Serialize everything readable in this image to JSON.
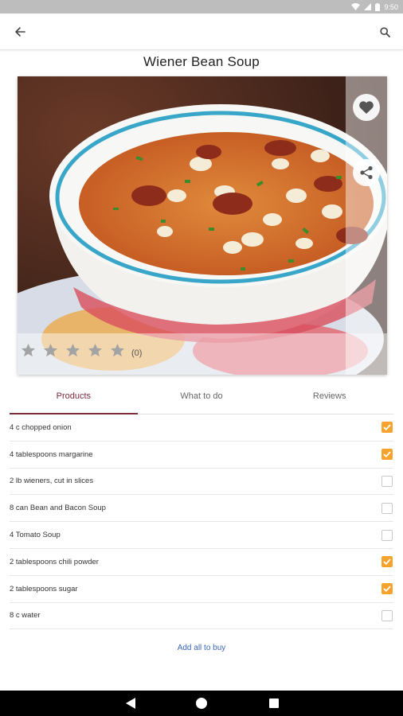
{
  "status_bar": {
    "time": "9:50",
    "icons": [
      "wifi-icon",
      "signal-icon",
      "battery-icon"
    ]
  },
  "app_bar": {
    "back_icon": "arrow-back-icon",
    "search_icon": "search-icon"
  },
  "recipe": {
    "title": "Wiener Bean Soup",
    "rating": {
      "stars_filled": 0,
      "stars_total": 5,
      "count_label": "(0)"
    }
  },
  "tabs": [
    {
      "label": "Products",
      "active": true
    },
    {
      "label": "What to do",
      "active": false
    },
    {
      "label": "Reviews",
      "active": false
    }
  ],
  "ingredients": [
    {
      "text": "4 c chopped onion",
      "checked": true
    },
    {
      "text": "4 tablespoons margarine",
      "checked": true
    },
    {
      "text": "2 lb wieners, cut in slices",
      "checked": false
    },
    {
      "text": "8 can Bean and Bacon Soup",
      "checked": false
    },
    {
      "text": "4 Tomato Soup",
      "checked": false
    },
    {
      "text": "2 tablespoons chili powder",
      "checked": true
    },
    {
      "text": "2 tablespoons sugar",
      "checked": true
    },
    {
      "text": "8 c water",
      "checked": false
    }
  ],
  "actions": {
    "add_all_label": "Add all to buy"
  },
  "colors": {
    "accent": "#7a2b3c",
    "checkbox_checked": "#f5a32c",
    "link": "#3b66b5"
  }
}
